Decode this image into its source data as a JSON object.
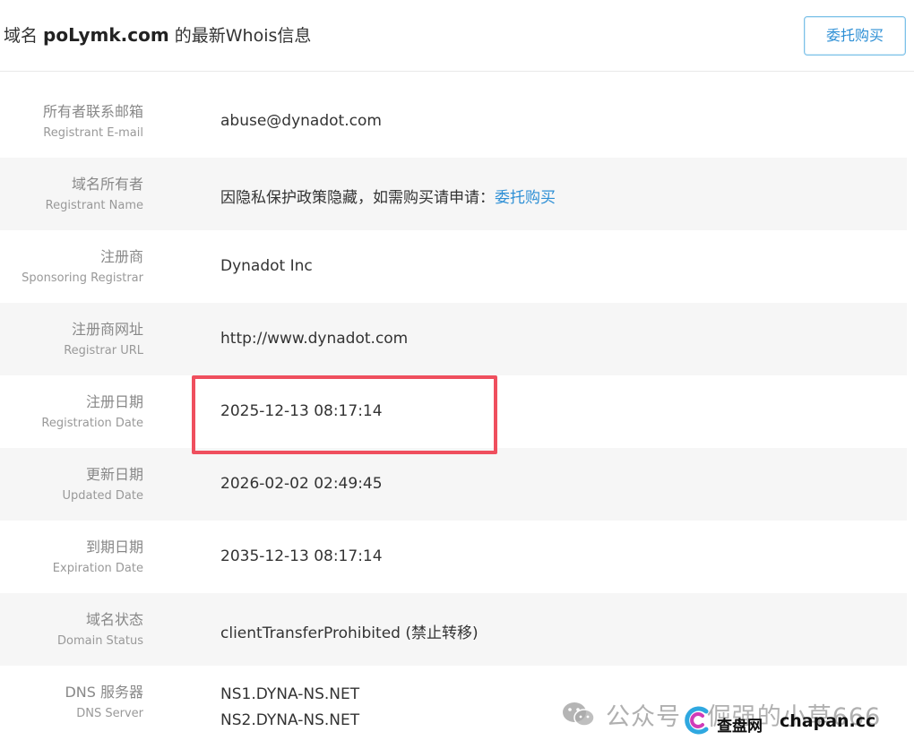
{
  "header": {
    "title_prefix": "域名 ",
    "domain": "poLymk.com",
    "title_suffix": " 的最新Whois信息",
    "buy_button": "委托购买"
  },
  "rows": [
    {
      "label_cn": "所有者联系邮箱",
      "label_en": "Registrant E-mail",
      "value": "abuse@dynadot.com"
    },
    {
      "label_cn": "域名所有者",
      "label_en": "Registrant Name",
      "value": "因隐私保护政策隐藏，如需购买请申请：",
      "link": "委托购买"
    },
    {
      "label_cn": "注册商",
      "label_en": "Sponsoring Registrar",
      "value": "Dynadot Inc"
    },
    {
      "label_cn": "注册商网址",
      "label_en": "Registrar URL",
      "value": "http://www.dynadot.com"
    },
    {
      "label_cn": "注册日期",
      "label_en": "Registration Date",
      "value": "2025-12-13 08:17:14"
    },
    {
      "label_cn": "更新日期",
      "label_en": "Updated Date",
      "value": "2026-02-02 02:49:45"
    },
    {
      "label_cn": "到期日期",
      "label_en": "Expiration Date",
      "value": "2035-12-13 08:17:14"
    },
    {
      "label_cn": "域名状态",
      "label_en": "Domain Status",
      "value": "clientTransferProhibited (禁止转移)"
    },
    {
      "label_cn": "DNS 服务器",
      "label_en": "DNS Server",
      "value": "NS1.DYNA-NS.NET",
      "value2": "NS2.DYNA-NS.NET"
    }
  ],
  "watermark": {
    "text": "公众号 · 倔强的小草666",
    "site_cn": "查盘网",
    "site_en": "chapan.cc",
    "icon": "wechat-icon"
  },
  "colors": {
    "accent": "#2d8fd5",
    "highlight": "#ef4f5e",
    "row_alt": "#f6f6f6"
  }
}
